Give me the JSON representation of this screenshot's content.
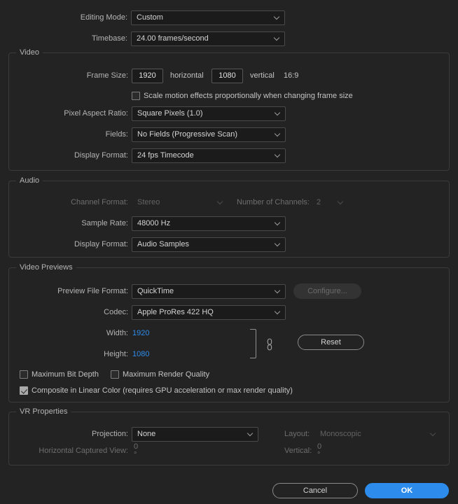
{
  "dialog": {
    "top_fields": [
      {
        "label": "Editing Mode:",
        "value": "Custom"
      },
      {
        "label": "Timebase:",
        "value": "24.00  frames/second"
      }
    ],
    "video": {
      "legend": "Video",
      "frame_size_label": "Frame Size:",
      "frame_width": "1920",
      "horizontal_label": "horizontal",
      "frame_height": "1080",
      "vertical_label": "vertical",
      "aspect_ratio_text": "16:9",
      "scale_motion_checkbox": {
        "label": "Scale motion effects proportionally when changing frame size",
        "checked": false
      },
      "fields": [
        {
          "label": "Pixel Aspect Ratio:",
          "value": "Square Pixels (1.0)"
        },
        {
          "label": "Fields:",
          "value": "No Fields (Progressive Scan)"
        },
        {
          "label": "Display Format:",
          "value": "24 fps Timecode"
        }
      ]
    },
    "audio": {
      "legend": "Audio",
      "channel_format_label": "Channel Format:",
      "channel_format_value": "Stereo",
      "channel_format_disabled": true,
      "num_channels_label": "Number of Channels:",
      "num_channels_value": "2",
      "num_channels_disabled": true,
      "fields": [
        {
          "label": "Sample Rate:",
          "value": "48000 Hz"
        },
        {
          "label": "Display Format:",
          "value": "Audio Samples"
        }
      ]
    },
    "video_previews": {
      "legend": "Video Previews",
      "preview_file_format_label": "Preview File Format:",
      "preview_file_format_value": "QuickTime",
      "configure_button": "Configure...",
      "configure_disabled": true,
      "codec_label": "Codec:",
      "codec_value": "Apple ProRes 422 HQ",
      "width_label": "Width:",
      "width_value": "1920",
      "height_label": "Height:",
      "height_value": "1080",
      "reset_button": "Reset",
      "link_icon": "chain-link-icon",
      "checkboxes": [
        {
          "label": "Maximum Bit Depth",
          "checked": false
        },
        {
          "label": "Maximum Render Quality",
          "checked": false
        },
        {
          "label": "Composite in Linear Color (requires GPU acceleration or max render quality)",
          "checked": true
        }
      ]
    },
    "vr_properties": {
      "legend": "VR Properties",
      "projection_label": "Projection:",
      "projection_value": "None",
      "layout_label": "Layout:",
      "layout_value": "Monoscopic",
      "layout_disabled": true,
      "horizontal_captured_label": "Horizontal Captured View:",
      "horizontal_captured_value": "0 °",
      "vertical_label": "Vertical:",
      "vertical_value": "0 °"
    },
    "footer": {
      "cancel_label": "Cancel",
      "ok_label": "OK"
    },
    "colors": {
      "background": "#232323",
      "accent_blue": "#2d8ceb",
      "field_bg": "#1b1b1b",
      "border": "#3b3b3b"
    }
  }
}
